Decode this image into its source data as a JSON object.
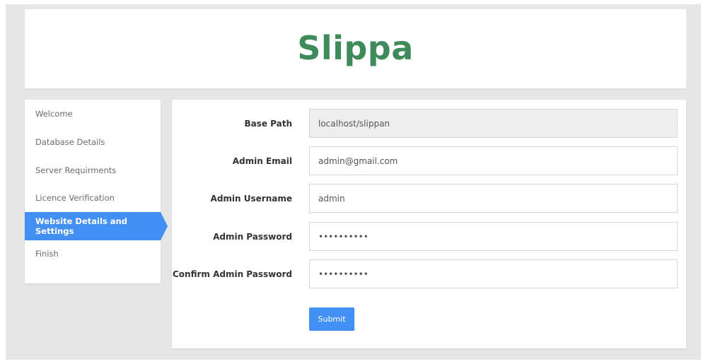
{
  "brand": {
    "title": "Slippa",
    "color": "#3f8a5b"
  },
  "sidebar": {
    "items": [
      {
        "label": "Welcome"
      },
      {
        "label": "Database Details"
      },
      {
        "label": "Server Requirments"
      },
      {
        "label": "Licence Verification"
      },
      {
        "label": "Website Details and Settings",
        "active": true
      },
      {
        "label": "Finish"
      }
    ]
  },
  "form": {
    "base_path": {
      "label": "Base Path",
      "value": "localhost/slippan"
    },
    "admin_email": {
      "label": "Admin Email",
      "value": "admin@gmail.com"
    },
    "admin_username": {
      "label": "Admin Username",
      "value": "admin"
    },
    "admin_password": {
      "label": "Admin Password",
      "value": "••••••••••"
    },
    "confirm_admin_password": {
      "label": "Confirm Admin Password",
      "value": "••••••••••"
    },
    "submit_label": "Submit"
  },
  "colors": {
    "accent": "#4390f4",
    "background": "#e6e6e6"
  }
}
